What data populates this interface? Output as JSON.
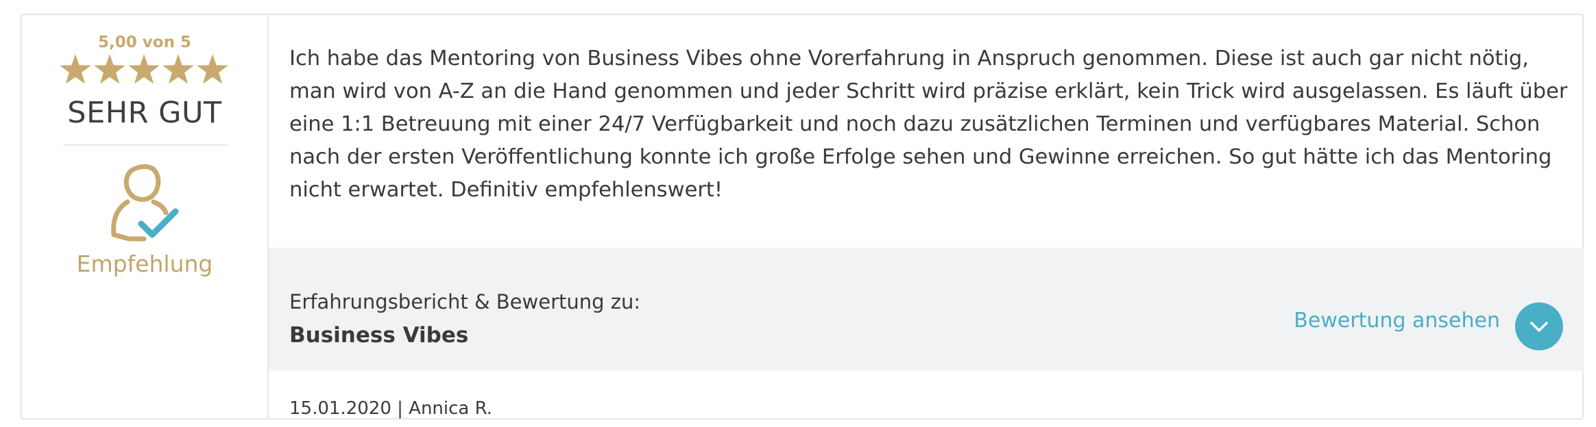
{
  "rating": {
    "score_text": "5,00 von 5",
    "stars": 5,
    "verdict": "SEHR GUT",
    "badge_label": "Empfehlung"
  },
  "review": {
    "text": "Ich habe das Mentoring von Business Vibes ohne Vorerfahrung in Anspruch genommen. Diese ist auch gar nicht nötig, man wird von A-Z an die Hand genommen und jeder Schritt wird präzise erklärt, kein Trick wird ausgelassen. Es läuft über eine 1:1 Betreuung mit einer 24/7 Verfügbarkeit und noch dazu zusätzlichen Terminen und verfügbares Material. Schon nach der ersten Veröffentlichung konnte ich große Erfolge sehen und Gewinne erreichen. So gut hätte ich das Mentoring nicht erwartet. Definitiv empfehlenswert!"
  },
  "subject": {
    "label": "Erfahrungsbericht & Bewertung zu:",
    "product": "Business Vibes",
    "link_label": "Bewertung ansehen"
  },
  "meta": {
    "date_author": "15.01.2020 | Annica R."
  },
  "colors": {
    "gold": "#c9a96e",
    "accent_blue": "#48afc7",
    "panel_gray": "#f1f2f3"
  }
}
